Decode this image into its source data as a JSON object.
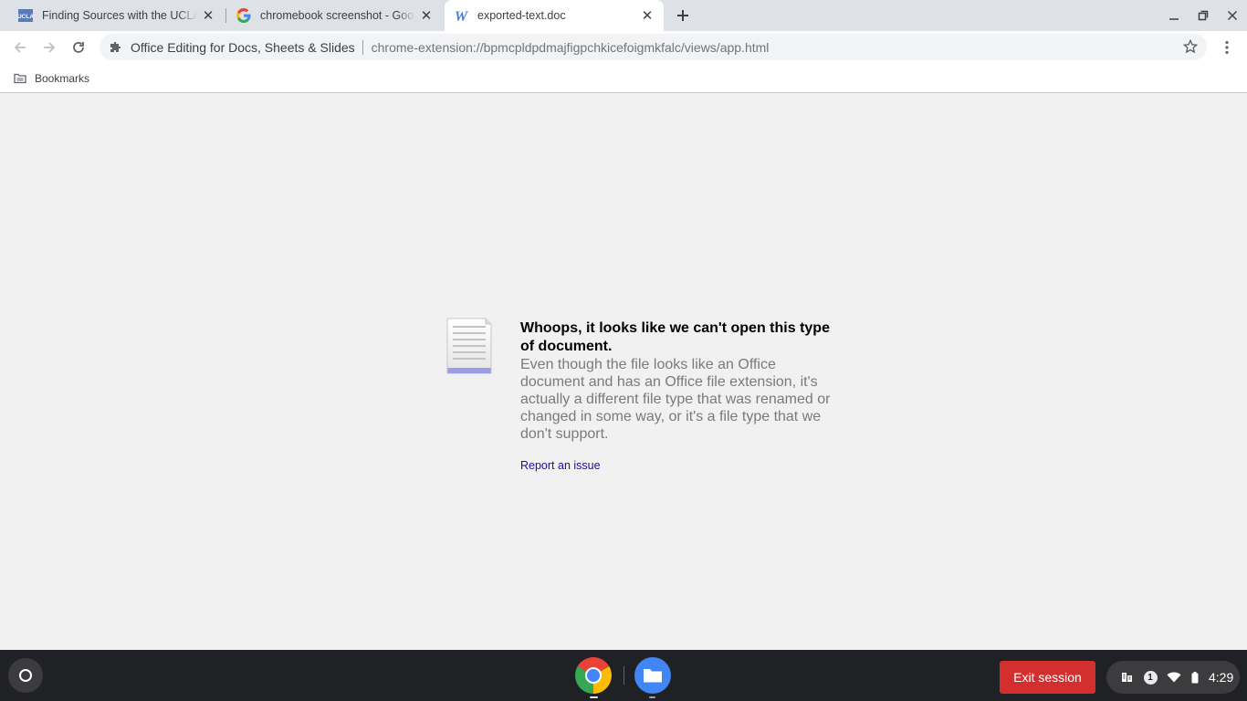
{
  "browser": {
    "tabs": [
      {
        "title": "Finding Sources with the UCLA L",
        "favicon": "ucla-icon",
        "active": false
      },
      {
        "title": "chromebook screenshot - Google",
        "favicon": "google-icon",
        "active": false
      },
      {
        "title": "exported-text.doc",
        "favicon": "word-icon",
        "active": true
      }
    ],
    "omnibox": {
      "origin": "Office Editing for Docs, Sheets & Slides",
      "url": "chrome-extension://bpmcpldpdmajfigpchkicefoigmkfalc/views/app.html"
    },
    "bookmarks_label": "Bookmarks"
  },
  "page": {
    "headline": "Whoops, it looks like we can't open this type of document.",
    "body": "Even though the file looks like an Office document and has an Office file extension, it's actually a different file type that was renamed or changed in some way, or it's a file type that we don't support.",
    "report_link": "Report an issue"
  },
  "shelf": {
    "apps": [
      "chrome-icon",
      "files-icon"
    ],
    "exit_session_label": "Exit session",
    "tray": {
      "notification_count": "1",
      "time": "4:29"
    }
  },
  "colors": {
    "tab_strip": "#dee1e6",
    "content_bg": "#f1f1f1",
    "link": "#1a0dab",
    "exit_button": "#d32f2f",
    "shelf": "#202124"
  }
}
